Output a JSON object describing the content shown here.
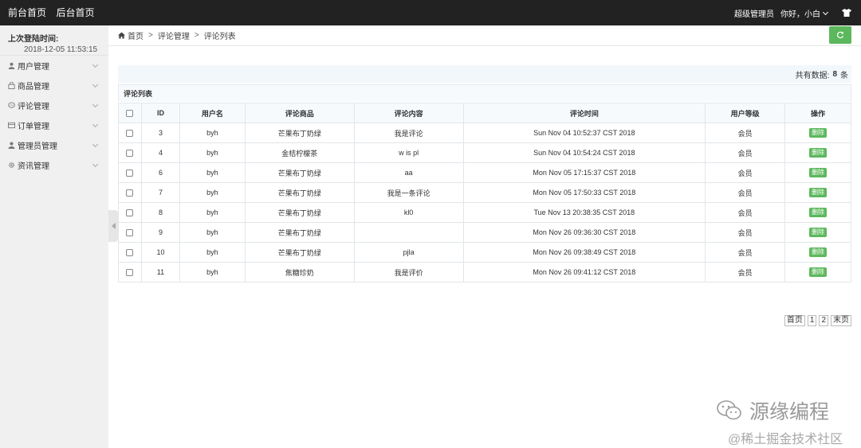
{
  "topbar": {
    "nav": [
      "前台首页",
      "后台首页"
    ],
    "role": "超级管理员",
    "greeting": "你好，小白"
  },
  "sidebar": {
    "login_label": "上次登陆时间:",
    "login_time": "2018-12-05 11:53:15",
    "items": [
      {
        "label": "用户管理",
        "icon": "user-icon"
      },
      {
        "label": "商品管理",
        "icon": "bag-icon"
      },
      {
        "label": "评论管理",
        "icon": "comment-icon"
      },
      {
        "label": "订单管理",
        "icon": "order-icon"
      },
      {
        "label": "管理员管理",
        "icon": "admin-icon"
      },
      {
        "label": "资讯管理",
        "icon": "gear-icon"
      }
    ]
  },
  "breadcrumb": [
    "首页",
    "评论管理",
    "评论列表"
  ],
  "count": {
    "prefix": "共有数据:",
    "value": "8",
    "suffix": "条"
  },
  "panel_title": "评论列表",
  "table": {
    "headers": [
      "ID",
      "用户名",
      "评论商品",
      "评论内容",
      "评论时间",
      "用户等级",
      "操作"
    ],
    "delete_label": "删除",
    "rows": [
      {
        "id": "3",
        "user": "byh",
        "product": "芒果布丁奶绿",
        "content": "我是评论",
        "time": "Sun Nov 04 10:52:37 CST 2018",
        "level": "会员"
      },
      {
        "id": "4",
        "user": "byh",
        "product": "金桔柠檬茶",
        "content": "w is pl",
        "time": "Sun Nov 04 10:54:24 CST 2018",
        "level": "会员"
      },
      {
        "id": "6",
        "user": "byh",
        "product": "芒果布丁奶绿",
        "content": "aa",
        "time": "Mon Nov 05 17:15:37 CST 2018",
        "level": "会员"
      },
      {
        "id": "7",
        "user": "byh",
        "product": "芒果布丁奶绿",
        "content": "我是一条评论",
        "time": "Mon Nov 05 17:50:33 CST 2018",
        "level": "会员"
      },
      {
        "id": "8",
        "user": "byh",
        "product": "芒果布丁奶绿",
        "content": "kl0",
        "time": "Tue Nov 13 20:38:35 CST 2018",
        "level": "会员"
      },
      {
        "id": "9",
        "user": "byh",
        "product": "芒果布丁奶绿",
        "content": "",
        "time": "Mon Nov 26 09:36:30 CST 2018",
        "level": "会员"
      },
      {
        "id": "10",
        "user": "byh",
        "product": "芒果布丁奶绿",
        "content": "pjla",
        "time": "Mon Nov 26 09:38:49 CST 2018",
        "level": "会员"
      },
      {
        "id": "11",
        "user": "byh",
        "product": "焦糖珍奶",
        "content": "我是评价",
        "time": "Mon Nov 26 09:41:12 CST 2018",
        "level": "会员"
      }
    ]
  },
  "pager": [
    "首页",
    "1",
    "2",
    "末页"
  ],
  "watermark": {
    "line1": "源缘编程",
    "line2": "@稀土掘金技术社区"
  },
  "colors": {
    "topbar": "#222222",
    "sidebar": "#f0f0f0",
    "accent": "#5cb85c"
  }
}
